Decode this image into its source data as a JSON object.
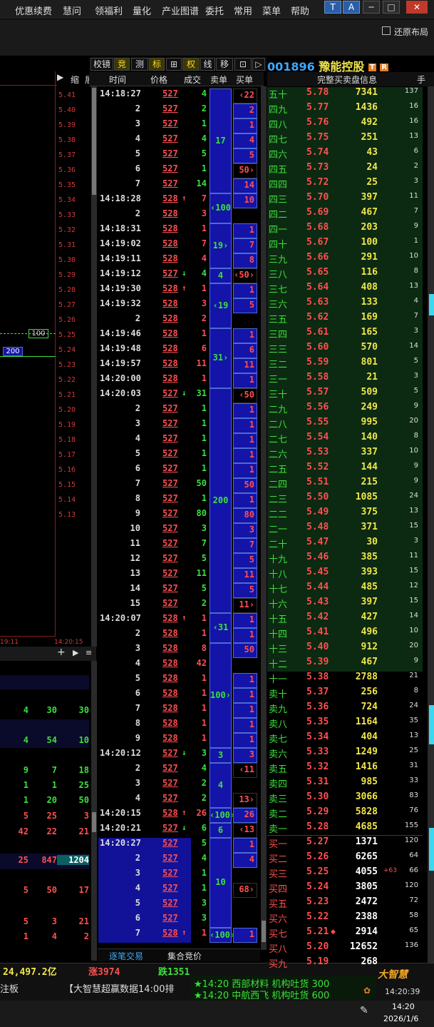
{
  "menu": [
    "优惠续费",
    "慧问",
    "领福利",
    "量化",
    "产业图谱",
    "委托",
    "常用",
    "菜单",
    "帮助"
  ],
  "window": {
    "min": "─",
    "max": "□",
    "close": "✕",
    "icon1": "T",
    "icon2": "A"
  },
  "restore_label": "还原布局",
  "tools": [
    "校镜",
    "竞",
    "测",
    "标",
    "⊞",
    "权",
    "线",
    "移",
    "⊡",
    "▷"
  ],
  "stock": {
    "code": "001896",
    "name": "豫能控股",
    "badges": [
      "T",
      "R"
    ]
  },
  "left_header": {
    "play": "▶",
    "zoom": "缩",
    "expand": "展"
  },
  "left_prices": [
    "5.41",
    "5.40",
    "5.39",
    "5.38",
    "5.37",
    "5.36",
    "5.35",
    "5.34",
    "5.33",
    "5.32",
    "5.31",
    "5.30",
    "5.29",
    "5.28",
    "5.27",
    "5.26",
    "5.25",
    "5.24",
    "5.23",
    "5.22",
    "5.21",
    "5.20",
    "5.19",
    "5.18",
    "5.17",
    "5.16",
    "5.15",
    "5.14",
    "5.13"
  ],
  "left_markers": {
    "m100": "100",
    "m200": "200",
    "t1": "19:11",
    "t2": "14:20:15"
  },
  "left_stats": [
    [
      "4",
      "30",
      "30"
    ],
    [
      "4",
      "54",
      "10"
    ],
    [
      "9",
      "7",
      "18"
    ],
    [
      "1",
      "1",
      "25"
    ],
    [
      "1",
      "20",
      "50"
    ],
    [
      "5",
      "25",
      "3"
    ],
    [
      "42",
      "22",
      "21"
    ],
    [
      "25",
      "847",
      "1204"
    ],
    [
      "5",
      "50",
      "17"
    ],
    [
      "5",
      "3",
      "21"
    ],
    [
      "1",
      "4",
      "2"
    ]
  ],
  "tick_headers": [
    "时间",
    "价格",
    "成交",
    "卖单",
    "买单"
  ],
  "ticks": [
    {
      "t": "14:18:27",
      "p": "527",
      "a": "",
      "v": "4",
      "vc": "g"
    },
    {
      "t": "2",
      "p": "527",
      "a": "",
      "v": "2",
      "vc": "g"
    },
    {
      "t": "3",
      "p": "527",
      "a": "",
      "v": "1",
      "vc": "g"
    },
    {
      "t": "4",
      "p": "527",
      "a": "",
      "v": "4",
      "vc": "g"
    },
    {
      "t": "5",
      "p": "527",
      "a": "",
      "v": "5",
      "vc": "g"
    },
    {
      "t": "6",
      "p": "527",
      "a": "",
      "v": "1",
      "vc": "g"
    },
    {
      "t": "7",
      "p": "527",
      "a": "",
      "v": "14",
      "vc": "g"
    },
    {
      "t": "14:18:28",
      "p": "528",
      "a": "↑",
      "v": "7",
      "vc": "r"
    },
    {
      "t": "2",
      "p": "528",
      "a": "",
      "v": "3",
      "vc": "r"
    },
    {
      "t": "14:18:31",
      "p": "528",
      "a": "",
      "v": "1",
      "vc": "r"
    },
    {
      "t": "14:19:02",
      "p": "528",
      "a": "",
      "v": "7",
      "vc": "r"
    },
    {
      "t": "14:19:11",
      "p": "528",
      "a": "",
      "v": "4",
      "vc": "r"
    },
    {
      "t": "14:19:12",
      "p": "527",
      "a": "↓",
      "v": "4",
      "vc": "g"
    },
    {
      "t": "14:19:30",
      "p": "528",
      "a": "↑",
      "v": "1",
      "vc": "r"
    },
    {
      "t": "14:19:32",
      "p": "528",
      "a": "",
      "v": "3",
      "vc": "r"
    },
    {
      "t": "2",
      "p": "528",
      "a": "",
      "v": "2",
      "vc": "r"
    },
    {
      "t": "14:19:46",
      "p": "528",
      "a": "",
      "v": "1",
      "vc": "r"
    },
    {
      "t": "14:19:48",
      "p": "528",
      "a": "",
      "v": "6",
      "vc": "r"
    },
    {
      "t": "14:19:57",
      "p": "528",
      "a": "",
      "v": "11",
      "vc": "r"
    },
    {
      "t": "14:20:00",
      "p": "528",
      "a": "",
      "v": "1",
      "vc": "r"
    },
    {
      "t": "14:20:03",
      "p": "527",
      "a": "↓",
      "v": "31",
      "vc": "g"
    },
    {
      "t": "2",
      "p": "527",
      "a": "",
      "v": "1",
      "vc": "g"
    },
    {
      "t": "3",
      "p": "527",
      "a": "",
      "v": "1",
      "vc": "g"
    },
    {
      "t": "4",
      "p": "527",
      "a": "",
      "v": "1",
      "vc": "g"
    },
    {
      "t": "5",
      "p": "527",
      "a": "",
      "v": "1",
      "vc": "g"
    },
    {
      "t": "6",
      "p": "527",
      "a": "",
      "v": "1",
      "vc": "g"
    },
    {
      "t": "7",
      "p": "527",
      "a": "",
      "v": "50",
      "vc": "g"
    },
    {
      "t": "8",
      "p": "527",
      "a": "",
      "v": "1",
      "vc": "g"
    },
    {
      "t": "9",
      "p": "527",
      "a": "",
      "v": "80",
      "vc": "g"
    },
    {
      "t": "10",
      "p": "527",
      "a": "",
      "v": "3",
      "vc": "g"
    },
    {
      "t": "11",
      "p": "527",
      "a": "",
      "v": "7",
      "vc": "g"
    },
    {
      "t": "12",
      "p": "527",
      "a": "",
      "v": "5",
      "vc": "g"
    },
    {
      "t": "13",
      "p": "527",
      "a": "",
      "v": "11",
      "vc": "g"
    },
    {
      "t": "14",
      "p": "527",
      "a": "",
      "v": "5",
      "vc": "g"
    },
    {
      "t": "15",
      "p": "527",
      "a": "",
      "v": "2",
      "vc": "g"
    },
    {
      "t": "14:20:07",
      "p": "528",
      "a": "↑",
      "v": "1",
      "vc": "r"
    },
    {
      "t": "2",
      "p": "528",
      "a": "",
      "v": "1",
      "vc": "r"
    },
    {
      "t": "3",
      "p": "528",
      "a": "",
      "v": "8",
      "vc": "r"
    },
    {
      "t": "4",
      "p": "528",
      "a": "",
      "v": "42",
      "vc": "r"
    },
    {
      "t": "5",
      "p": "528",
      "a": "",
      "v": "1",
      "vc": "r"
    },
    {
      "t": "6",
      "p": "528",
      "a": "",
      "v": "1",
      "vc": "r"
    },
    {
      "t": "7",
      "p": "528",
      "a": "",
      "v": "1",
      "vc": "r"
    },
    {
      "t": "8",
      "p": "528",
      "a": "",
      "v": "1",
      "vc": "r"
    },
    {
      "t": "9",
      "p": "528",
      "a": "",
      "v": "1",
      "vc": "r"
    },
    {
      "t": "14:20:12",
      "p": "527",
      "a": "↓",
      "v": "3",
      "vc": "g"
    },
    {
      "t": "2",
      "p": "527",
      "a": "",
      "v": "4",
      "vc": "g"
    },
    {
      "t": "3",
      "p": "527",
      "a": "",
      "v": "2",
      "vc": "g"
    },
    {
      "t": "4",
      "p": "527",
      "a": "",
      "v": "2",
      "vc": "g"
    },
    {
      "t": "14:20:15",
      "p": "528",
      "a": "↑",
      "v": "26",
      "vc": "r"
    },
    {
      "t": "14:20:21",
      "p": "527",
      "a": "↓",
      "v": "6",
      "vc": "g"
    },
    {
      "t": "14:20:27",
      "p": "527",
      "a": "",
      "v": "5",
      "vc": "g"
    },
    {
      "t": "2",
      "p": "527",
      "a": "",
      "v": "4",
      "vc": "g"
    },
    {
      "t": "3",
      "p": "527",
      "a": "",
      "v": "1",
      "vc": "g"
    },
    {
      "t": "4",
      "p": "527",
      "a": "",
      "v": "1",
      "vc": "g"
    },
    {
      "t": "5",
      "p": "527",
      "a": "",
      "v": "3",
      "vc": "g"
    },
    {
      "t": "6",
      "p": "527",
      "a": "",
      "v": "3",
      "vc": "g"
    },
    {
      "t": "7",
      "p": "528",
      "a": "↑",
      "v": "1",
      "vc": "r"
    }
  ],
  "sell_blocks": [
    {
      "r0": 0,
      "r1": 6,
      "txt": "17"
    },
    {
      "r0": 7,
      "r1": 8,
      "txt": "‹100"
    },
    {
      "r0": 9,
      "r1": 11,
      "txt": "19›"
    },
    {
      "r0": 12,
      "r1": 12,
      "txt": "4"
    },
    {
      "r0": 13,
      "r1": 15,
      "txt": "‹19"
    },
    {
      "r0": 16,
      "r1": 19,
      "txt": "31›"
    },
    {
      "r0": 20,
      "r1": 34,
      "txt": "200"
    },
    {
      "r0": 35,
      "r1": 36,
      "txt": "‹31"
    },
    {
      "r0": 37,
      "r1": 43,
      "txt": "100›"
    },
    {
      "r0": 44,
      "r1": 44,
      "txt": "3"
    },
    {
      "r0": 45,
      "r1": 47,
      "txt": "4"
    },
    {
      "r0": 48,
      "r1": 48,
      "txt": "‹100›"
    },
    {
      "r0": 49,
      "r1": 49,
      "txt": "6"
    },
    {
      "r0": 50,
      "r1": 55,
      "txt": "10"
    },
    {
      "r0": 56,
      "r1": 56,
      "txt": "‹100›"
    }
  ],
  "buy_values": [
    "‹22",
    "2",
    "1",
    "4",
    "5",
    "50›",
    "14",
    "10",
    "",
    "1",
    "7",
    "8",
    "‹50›",
    "1",
    "5",
    "",
    "1",
    "6",
    "11",
    "1",
    "‹50",
    "1",
    "1",
    "1",
    "1",
    "1",
    "50",
    "1",
    "80",
    "3",
    "7",
    "5",
    "11",
    "5",
    "11›",
    "1",
    "1",
    "50",
    "",
    "1",
    "1",
    "1",
    "1",
    "1",
    "3",
    "‹11",
    "",
    "13›",
    "26",
    "‹13",
    "1",
    "4",
    "",
    "68›",
    "",
    "",
    "1"
  ],
  "ob_header": "完整买卖盘信息",
  "ob_header_right": "手",
  "order_book": [
    {
      "l": "五十",
      "p": "5.78",
      "v": "7341",
      "c": "137"
    },
    {
      "l": "四九",
      "p": "5.77",
      "v": "1436",
      "c": "16"
    },
    {
      "l": "四八",
      "p": "5.76",
      "v": "492",
      "c": "16"
    },
    {
      "l": "四七",
      "p": "5.75",
      "v": "251",
      "c": "13"
    },
    {
      "l": "四六",
      "p": "5.74",
      "v": "43",
      "c": "6"
    },
    {
      "l": "四五",
      "p": "5.73",
      "v": "24",
      "c": "2"
    },
    {
      "l": "四四",
      "p": "5.72",
      "v": "25",
      "c": "3"
    },
    {
      "l": "四三",
      "p": "5.70",
      "v": "397",
      "c": "11"
    },
    {
      "l": "四二",
      "p": "5.69",
      "v": "467",
      "c": "7"
    },
    {
      "l": "四一",
      "p": "5.68",
      "v": "203",
      "c": "9"
    },
    {
      "l": "四十",
      "p": "5.67",
      "v": "100",
      "c": "1"
    },
    {
      "l": "三九",
      "p": "5.66",
      "v": "291",
      "c": "10"
    },
    {
      "l": "三八",
      "p": "5.65",
      "v": "116",
      "c": "8"
    },
    {
      "l": "三七",
      "p": "5.64",
      "v": "408",
      "c": "13"
    },
    {
      "l": "三六",
      "p": "5.63",
      "v": "133",
      "c": "4"
    },
    {
      "l": "三五",
      "p": "5.62",
      "v": "169",
      "c": "7"
    },
    {
      "l": "三四",
      "p": "5.61",
      "v": "165",
      "c": "3"
    },
    {
      "l": "三三",
      "p": "5.60",
      "v": "570",
      "c": "14"
    },
    {
      "l": "三二",
      "p": "5.59",
      "v": "801",
      "c": "5"
    },
    {
      "l": "三一",
      "p": "5.58",
      "v": "21",
      "c": "3"
    },
    {
      "l": "三十",
      "p": "5.57",
      "v": "509",
      "c": "5"
    },
    {
      "l": "二九",
      "p": "5.56",
      "v": "249",
      "c": "9"
    },
    {
      "l": "二八",
      "p": "5.55",
      "v": "995",
      "c": "20"
    },
    {
      "l": "二七",
      "p": "5.54",
      "v": "140",
      "c": "8"
    },
    {
      "l": "二六",
      "p": "5.53",
      "v": "337",
      "c": "10"
    },
    {
      "l": "二五",
      "p": "5.52",
      "v": "144",
      "c": "9"
    },
    {
      "l": "二四",
      "p": "5.51",
      "v": "215",
      "c": "9"
    },
    {
      "l": "二三",
      "p": "5.50",
      "v": "1085",
      "c": "24"
    },
    {
      "l": "二二",
      "p": "5.49",
      "v": "375",
      "c": "13"
    },
    {
      "l": "二一",
      "p": "5.48",
      "v": "371",
      "c": "15"
    },
    {
      "l": "二十",
      "p": "5.47",
      "v": "30",
      "c": "3"
    },
    {
      "l": "十九",
      "p": "5.46",
      "v": "385",
      "c": "11"
    },
    {
      "l": "十八",
      "p": "5.45",
      "v": "393",
      "c": "15"
    },
    {
      "l": "十七",
      "p": "5.44",
      "v": "485",
      "c": "12"
    },
    {
      "l": "十六",
      "p": "5.43",
      "v": "397",
      "c": "15"
    },
    {
      "l": "十五",
      "p": "5.42",
      "v": "427",
      "c": "14"
    },
    {
      "l": "十四",
      "p": "5.41",
      "v": "496",
      "c": "10"
    },
    {
      "l": "十三",
      "p": "5.40",
      "v": "912",
      "c": "20"
    },
    {
      "l": "十二",
      "p": "5.39",
      "v": "467",
      "c": "9"
    },
    {
      "l": "十一",
      "p": "5.38",
      "v": "2788",
      "c": "21"
    },
    {
      "l": "卖十",
      "p": "5.37",
      "v": "256",
      "c": "8"
    },
    {
      "l": "卖九",
      "p": "5.36",
      "v": "724",
      "c": "24"
    },
    {
      "l": "卖八",
      "p": "5.35",
      "v": "1164",
      "c": "35"
    },
    {
      "l": "卖七",
      "p": "5.34",
      "v": "404",
      "c": "13"
    },
    {
      "l": "卖六",
      "p": "5.33",
      "v": "1249",
      "c": "25"
    },
    {
      "l": "卖五",
      "p": "5.32",
      "v": "1416",
      "c": "31"
    },
    {
      "l": "卖四",
      "p": "5.31",
      "v": "985",
      "c": "33"
    },
    {
      "l": "卖三",
      "p": "5.30",
      "v": "3066",
      "c": "83"
    },
    {
      "l": "卖二",
      "p": "5.29",
      "v": "5828",
      "c": "76"
    },
    {
      "l": "卖一",
      "p": "5.28",
      "v": "4685",
      "c": "155"
    },
    {
      "l": "买一",
      "p": "5.27",
      "v": "1371",
      "c": "120"
    },
    {
      "l": "买二",
      "p": "5.26",
      "v": "6265",
      "c": "64"
    },
    {
      "l": "买三",
      "p": "5.25",
      "v": "4055",
      "c": "66"
    },
    {
      "l": "买四",
      "p": "5.24",
      "v": "3805",
      "c": "120"
    },
    {
      "l": "买五",
      "p": "5.23",
      "v": "2472",
      "c": "72"
    },
    {
      "l": "买六",
      "p": "5.22",
      "v": "2388",
      "c": "58"
    },
    {
      "l": "买七",
      "p": "5.21",
      "v": "2914",
      "c": "65"
    },
    {
      "l": "买八",
      "p": "5.20",
      "v": "12652",
      "c": "136"
    },
    {
      "l": "买九",
      "p": "5.19",
      "v": "268",
      "c": ""
    }
  ],
  "ob_extra": "+63",
  "bottom_tabs": [
    "逐笔交易",
    "集合竞价"
  ],
  "status": {
    "amount": "24,497.2亿",
    "up": "涨3974",
    "down": "跌1351"
  },
  "news": [
    "★14:20 西部材料 机构吐货 300",
    "★14:20 中航西飞 机构吐货 600"
  ],
  "ticker": "【大智慧超赢数据14:00排",
  "ticker_left": "注板",
  "brand": "大智慧",
  "clock": "14:20:39",
  "taskbar": {
    "time": "14:20",
    "date": "2026/1/6"
  },
  "colors": {
    "up": "#ff5050",
    "down": "#3ce03c",
    "vol": "#f2e64b",
    "accent": "#3aa8ff",
    "block": "#1414a8"
  }
}
